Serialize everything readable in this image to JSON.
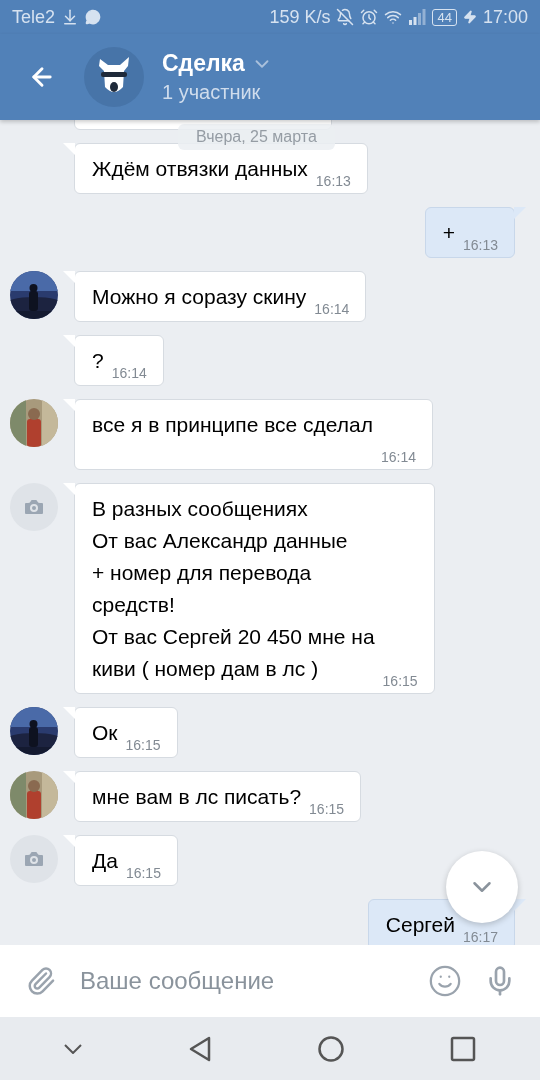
{
  "status_bar": {
    "carrier": "Tele2",
    "speed": "159 K/s",
    "battery": "44",
    "time": "17:00"
  },
  "header": {
    "title": "Сделка",
    "subtitle": "1 участник"
  },
  "date_pill": "Вчера, 25 марта",
  "messages": [
    {
      "outgoing": false,
      "text": "Ждём отвязки данных",
      "time": "16:13",
      "time_below": false
    },
    {
      "outgoing": true,
      "text": "+",
      "time": "16:13",
      "time_below": false
    },
    {
      "outgoing": false,
      "avatar": {
        "kind": "night"
      },
      "text": "Можно я соразу скину",
      "time": "16:14",
      "time_below": false
    },
    {
      "outgoing": false,
      "text": "?",
      "time": "16:14",
      "time_below": false
    },
    {
      "outgoing": false,
      "avatar": {
        "kind": "person"
      },
      "text": "все я в принципе все сделал",
      "time": "16:14",
      "time_below": true
    },
    {
      "outgoing": false,
      "avatar": {
        "kind": "camera"
      },
      "text": "В разных сообщениях\nОт вас Александр данные\n+ номер для перевода\nсредств!\nОт вас Сергей 20 450 мне на\nкиви ( номер дам в лс )",
      "time": "16:15",
      "time_below": false
    },
    {
      "outgoing": false,
      "avatar": {
        "kind": "night"
      },
      "text": "Ок",
      "time": "16:15",
      "time_below": false
    },
    {
      "outgoing": false,
      "avatar": {
        "kind": "person"
      },
      "text": "мне вам в лс писать?",
      "time": "16:15",
      "time_below": false
    },
    {
      "outgoing": false,
      "avatar": {
        "kind": "camera"
      },
      "text": "Да",
      "time": "16:15",
      "time_below": false
    },
    {
      "outgoing": true,
      "text": "Сергей",
      "time": "16:17",
      "time_below": false
    }
  ],
  "composer": {
    "placeholder": "Ваше сообщение"
  }
}
